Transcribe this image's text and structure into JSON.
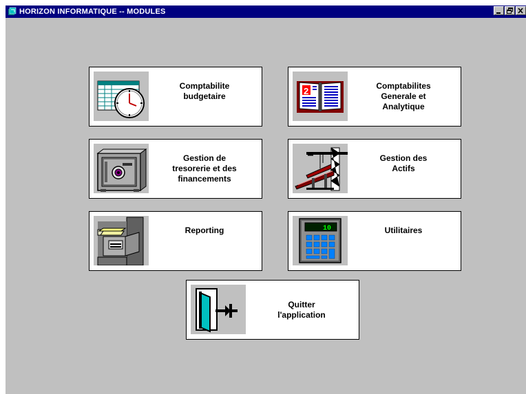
{
  "window": {
    "title": "HORIZON INFORMATIQUE -- MODULES",
    "buttons": [
      "minimize",
      "restore",
      "close"
    ]
  },
  "colors": {
    "titlebar": "#000080",
    "background": "#c0c0c0",
    "tile": "#ffffff"
  },
  "modules": [
    {
      "id": "comptabilite-budgetaire",
      "label": "Comptabilite\nbudgetaire",
      "icon": "spreadsheet-clock-icon"
    },
    {
      "id": "comptabilites-generale",
      "label": "Comptabilites\nGenerale et\nAnalytique",
      "icon": "ledger-book-icon"
    },
    {
      "id": "gestion-tresorerie",
      "label": "Gestion de\ntresorerie et des\nfinancements",
      "icon": "safe-icon"
    },
    {
      "id": "gestion-actifs",
      "label": "Gestion des\nActifs",
      "icon": "crane-icon"
    },
    {
      "id": "reporting",
      "label": "Reporting",
      "icon": "filing-cabinet-icon"
    },
    {
      "id": "utilitaires",
      "label": "Utilitaires",
      "icon": "calculator-icon"
    },
    {
      "id": "quitter",
      "label": "Quitter\nl'application",
      "icon": "exit-door-icon"
    }
  ]
}
